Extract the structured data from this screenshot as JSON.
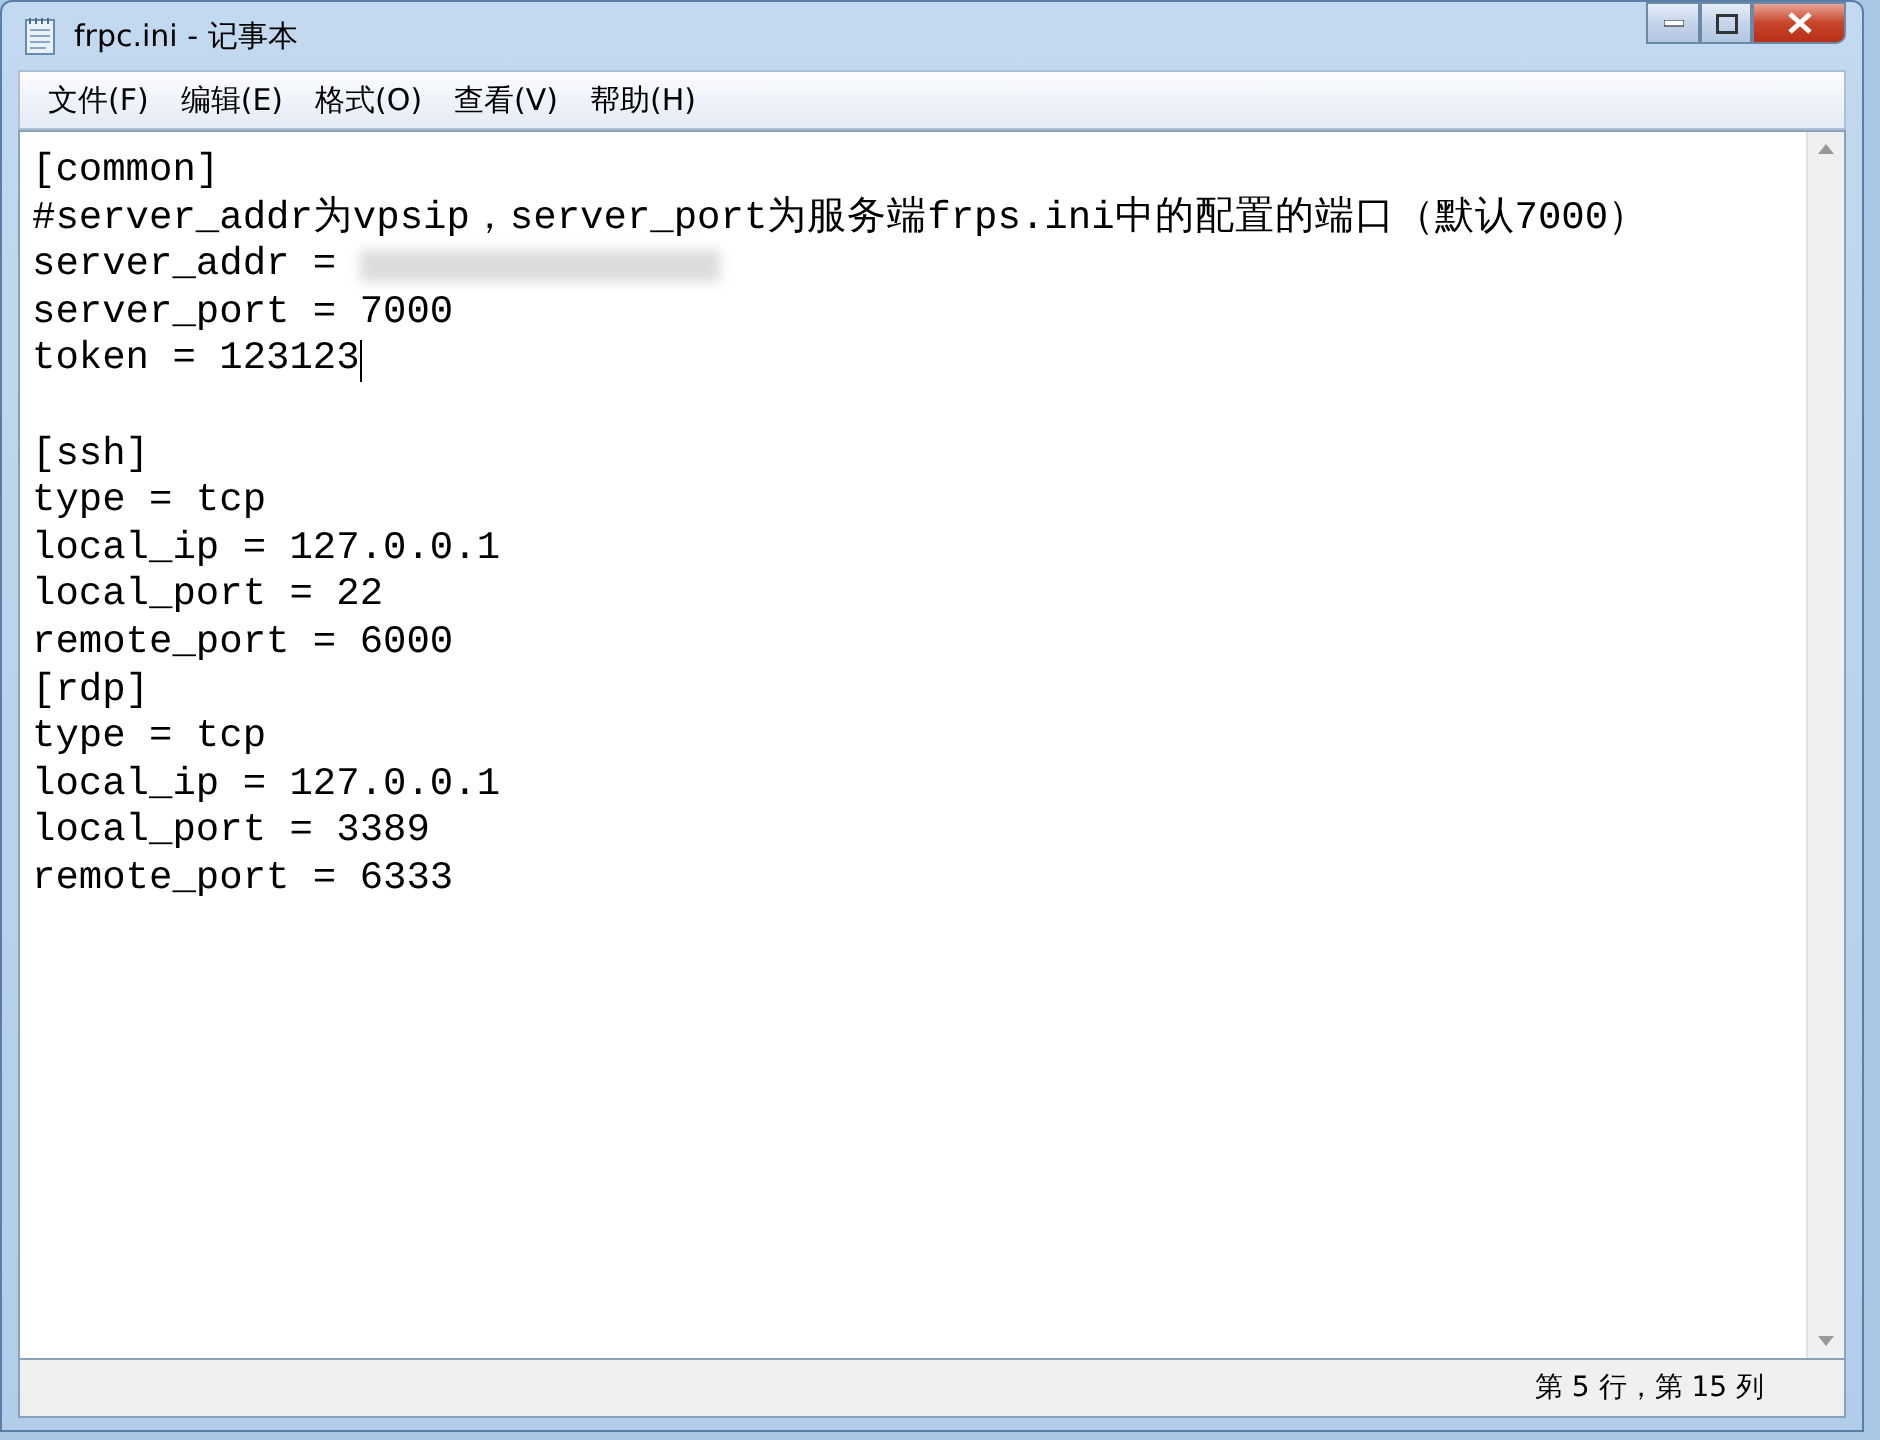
{
  "window": {
    "title": "frpc.ini - 记事本"
  },
  "menu": [
    "文件(F)",
    "编辑(E)",
    "格式(O)",
    "查看(V)",
    "帮助(H)"
  ],
  "lines": [
    {
      "kind": "text",
      "text": "[common]",
      "cursor": false
    },
    {
      "kind": "text",
      "text": "#server_addr为vpsip，server_port为服务端frps.ini中的配置的端口（默认7000）",
      "cursor": false
    },
    {
      "kind": "redacted",
      "text": "server_addr = ",
      "cursor": false
    },
    {
      "kind": "text",
      "text": "server_port = 7000",
      "cursor": false
    },
    {
      "kind": "text",
      "text": "token = 123123",
      "cursor": true
    },
    {
      "kind": "blank",
      "cursor": false
    },
    {
      "kind": "text",
      "text": "[ssh]",
      "cursor": false
    },
    {
      "kind": "text",
      "text": "type = tcp",
      "cursor": false
    },
    {
      "kind": "text",
      "text": "local_ip = 127.0.0.1",
      "cursor": false
    },
    {
      "kind": "text",
      "text": "local_port = 22",
      "cursor": false
    },
    {
      "kind": "text",
      "text": "remote_port = 6000",
      "cursor": false
    },
    {
      "kind": "text",
      "text": "[rdp]",
      "cursor": false
    },
    {
      "kind": "text",
      "text": "type = tcp",
      "cursor": false
    },
    {
      "kind": "text",
      "text": "local_ip = 127.0.0.1",
      "cursor": false
    },
    {
      "kind": "text",
      "text": "local_port = 3389",
      "cursor": false
    },
    {
      "kind": "text",
      "text": "remote_port = 6333",
      "cursor": false
    }
  ],
  "status_bar": {
    "position": "第 5 行，第 15 列"
  }
}
